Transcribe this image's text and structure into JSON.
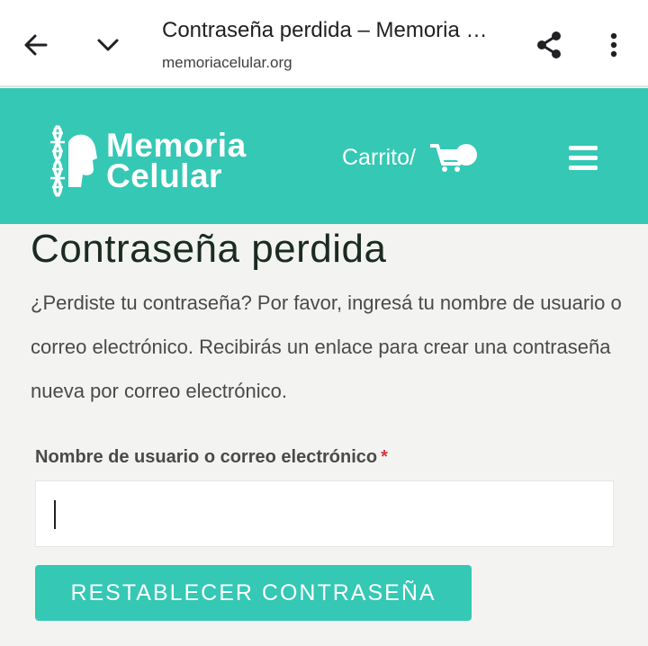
{
  "browser": {
    "title": "Contraseña perdida – Memoria …",
    "url": "memoriacelular.org"
  },
  "header": {
    "logo_line1": "Memoria",
    "logo_line2": "Celular",
    "cart_label": "Carrito/",
    "brand_color": "#34c8b5"
  },
  "main": {
    "title": "Contraseña perdida",
    "intro": "¿Perdiste tu contraseña? Por favor, ingresá tu nombre de usuario o correo electrónico. Recibirás un enlace para crear una contraseña nueva por correo electrónico.",
    "field_label": "Nombre de usuario o correo electrónico",
    "required_mark": "*",
    "field_value": "",
    "submit_label": "RESTABLECER CONTRASEÑA"
  }
}
